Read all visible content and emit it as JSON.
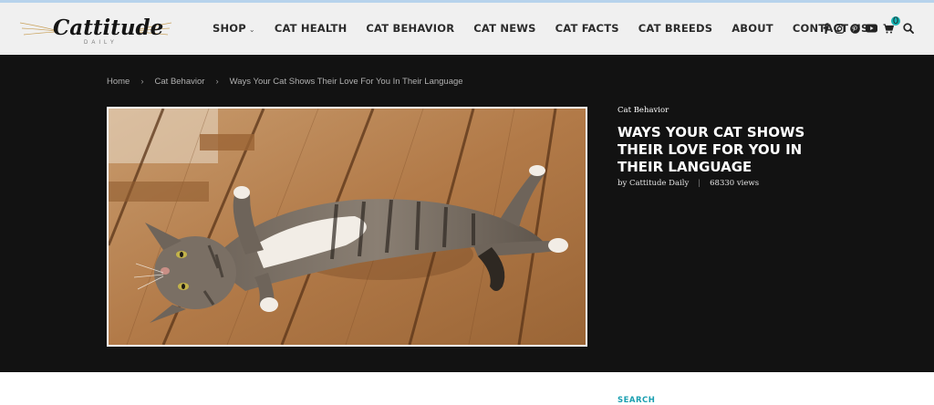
{
  "brand": {
    "logo_text": "Cattitude",
    "logo_subtext": "DAILY"
  },
  "nav": {
    "items": [
      {
        "label": "SHOP",
        "has_dropdown": true
      },
      {
        "label": "CAT HEALTH"
      },
      {
        "label": "CAT BEHAVIOR"
      },
      {
        "label": "CAT NEWS"
      },
      {
        "label": "CAT FACTS"
      },
      {
        "label": "CAT BREEDS"
      },
      {
        "label": "ABOUT"
      },
      {
        "label": "CONTACT US"
      }
    ],
    "dropdown_caret": "⌄"
  },
  "social": {
    "icons": [
      "facebook-icon",
      "instagram-icon",
      "pinterest-icon",
      "youtube-icon",
      "cart-icon",
      "search-icon"
    ],
    "cart_count": "0"
  },
  "breadcrumb": {
    "home": "Home",
    "category": "Cat Behavior",
    "current": "Ways Your Cat Shows Their Love For You In Their Language",
    "separator": "›"
  },
  "article": {
    "category": "Cat Behavior",
    "title": "WAYS YOUR CAT SHOWS THEIR LOVE FOR YOU IN THEIR LANGUAGE",
    "author": "by Cattitude Daily",
    "views": "68330 views"
  },
  "sidebar": {
    "search_title": "SEARCH"
  },
  "colors": {
    "header_bg": "#f0f0f0",
    "hero_bg": "#121212",
    "accent": "#1a9fb0",
    "badge": "#14b3b3"
  }
}
